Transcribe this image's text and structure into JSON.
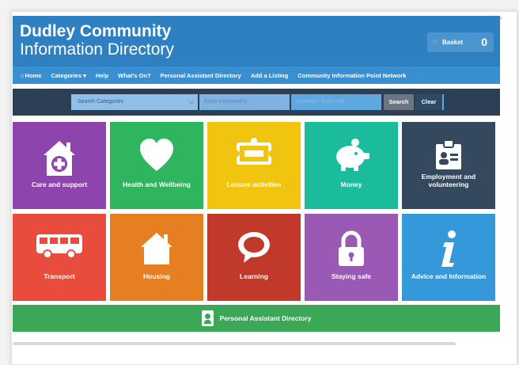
{
  "header": {
    "title_line1": "Dudley Community",
    "title_line2": "Information Directory",
    "basket_label": "Basket",
    "basket_count": "0"
  },
  "nav": {
    "items": [
      "Home",
      "Categories",
      "Help",
      "What's On?",
      "Personal Assistant Directory",
      "Add a Listing",
      "Community Information Point Network"
    ]
  },
  "search": {
    "category_placeholder": "Search Categories",
    "keyword_placeholder": "Enter Keyword(s)",
    "location_placeholder": "Location / Postcode",
    "search_label": "Search",
    "clear_label": "Clear"
  },
  "tiles": [
    {
      "label": "Care and support",
      "color": "#8e44ad",
      "icon": "house-plus-icon"
    },
    {
      "label": "Health and Wellbeing",
      "color": "#2fb55d",
      "icon": "heart-icon"
    },
    {
      "label": "Leisure activities",
      "color": "#f1c40f",
      "icon": "ticket-icon"
    },
    {
      "label": "Money",
      "color": "#1abc9c",
      "icon": "piggy-bank-icon"
    },
    {
      "label": "Employment and volunteering",
      "color": "#34495e",
      "icon": "id-badge-icon"
    },
    {
      "label": "Transport",
      "color": "#e74c3c",
      "icon": "bus-icon"
    },
    {
      "label": "Housing",
      "color": "#e67e22",
      "icon": "house-icon"
    },
    {
      "label": "Learning",
      "color": "#c0392b",
      "icon": "speech-bubble-icon"
    },
    {
      "label": "Staying safe",
      "color": "#9b59b6",
      "icon": "padlock-icon"
    },
    {
      "label": "Advice and Information",
      "color": "#3498db",
      "icon": "info-icon"
    }
  ],
  "pa_bar": {
    "label": "Personal Assistant Directory",
    "color": "#3aa857"
  }
}
